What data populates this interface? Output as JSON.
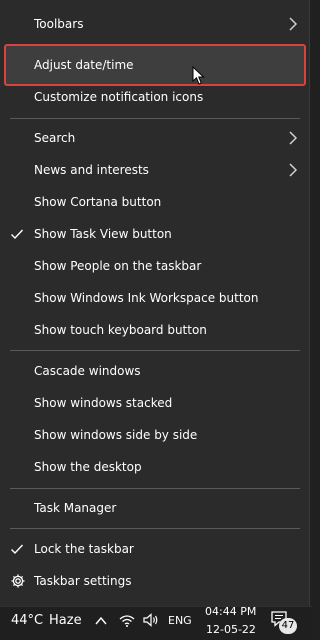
{
  "menu": {
    "items": [
      {
        "label": "Toolbars",
        "submenu": true
      },
      {
        "label": "Adjust date/time",
        "highlighted": true
      },
      {
        "label": "Customize notification icons"
      },
      {
        "label": "Search",
        "submenu": true
      },
      {
        "label": "News and interests",
        "submenu": true
      },
      {
        "label": "Show Cortana button"
      },
      {
        "label": "Show Task View button",
        "checked": true
      },
      {
        "label": "Show People on the taskbar"
      },
      {
        "label": "Show Windows Ink Workspace button"
      },
      {
        "label": "Show touch keyboard button"
      },
      {
        "label": "Cascade windows"
      },
      {
        "label": "Show windows stacked"
      },
      {
        "label": "Show windows side by side"
      },
      {
        "label": "Show the desktop"
      },
      {
        "label": "Task Manager"
      },
      {
        "label": "Lock the taskbar",
        "checked": true
      },
      {
        "label": "Taskbar settings",
        "icon": "gear-icon"
      }
    ]
  },
  "taskbar": {
    "temperature": "44°C",
    "weather": "Haze",
    "language": "ENG",
    "time": "04:44 PM",
    "date": "12-05-22",
    "notification_count": "47"
  },
  "colors": {
    "menu_bg": "#2b2b2b",
    "highlight_bg": "#3e3e3e",
    "highlight_border": "#d9433b",
    "taskbar_bg": "#1f1f1f"
  }
}
